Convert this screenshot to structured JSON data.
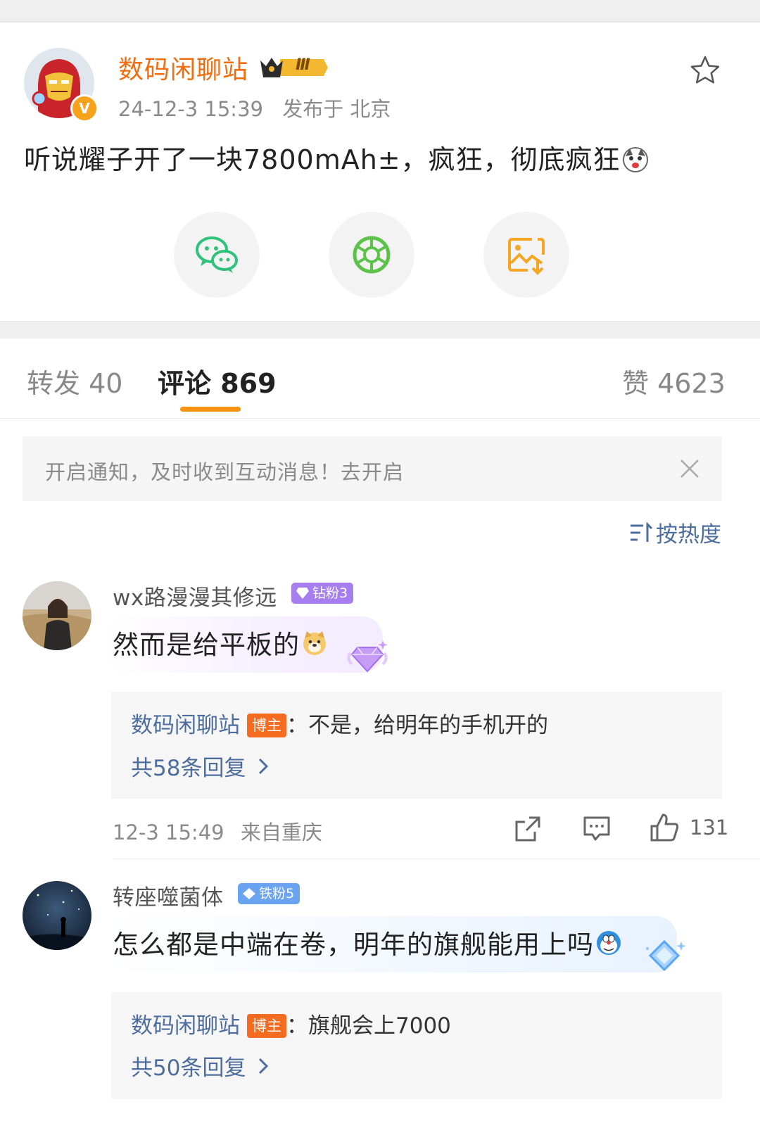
{
  "post": {
    "author": "数码闲聊站",
    "level_badge": "Ⅲ",
    "verified_badge": "V",
    "time": "24-12-3 15:39",
    "location": "发布于 北京",
    "text": "听说耀子开了一块7800mAh±，疯狂，彻底疯狂",
    "share_icons": [
      "wechat-icon",
      "moments-icon",
      "save-image-icon"
    ]
  },
  "tabs": {
    "repost": "转发 40",
    "comment": "评论 869",
    "like": "赞 4623"
  },
  "notice": {
    "text": "开启通知，及时收到互动消息！去开启"
  },
  "sort": {
    "label": "按热度"
  },
  "comments": [
    {
      "name": "wx路漫漫其修远",
      "badge": "钻粉3",
      "badge_color": "#a67ef0",
      "text": "然而是给平板的",
      "reply": {
        "author": "数码闲聊站",
        "tag": "博主",
        "text": "：不是，给明年的手机开的",
        "count": "共58条回复"
      },
      "time": "12-3 15:49",
      "location": "来自重庆",
      "likes": "131"
    },
    {
      "name": "转座噬菌体",
      "badge": "铁粉5",
      "badge_color": "#6aa4f0",
      "text": "怎么都是中端在卷，明年的旗舰能用上吗",
      "reply": {
        "author": "数码闲聊站",
        "tag": "博主",
        "text": "：旗舰会上7000",
        "count": "共50条回复"
      }
    }
  ],
  "colors": {
    "accent_orange": "#f7930e",
    "author_orange": "#f06e10",
    "link_blue": "#4d6d9e",
    "wechat_green": "#2fc27b",
    "moments_green": "#5cc24a"
  }
}
